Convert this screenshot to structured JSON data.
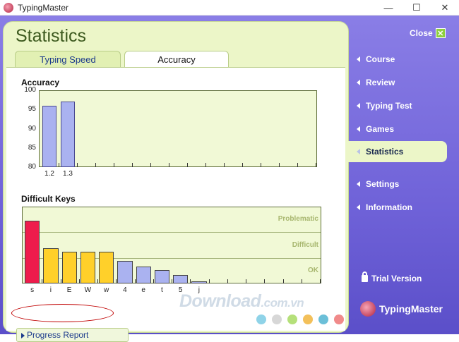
{
  "window": {
    "title": "TypingMaster",
    "minimize": "—",
    "maximize": "☐",
    "close": "✕"
  },
  "page": {
    "title": "Statistics",
    "tabs": [
      {
        "label": "Typing Speed"
      },
      {
        "label": "Accuracy"
      }
    ],
    "progress_report": "Progress Report"
  },
  "sidebar": {
    "close_label": "Close",
    "items": [
      {
        "label": "Course"
      },
      {
        "label": "Review"
      },
      {
        "label": "Typing Test"
      },
      {
        "label": "Games"
      },
      {
        "label": "Statistics"
      },
      {
        "label": "Settings"
      },
      {
        "label": "Information"
      }
    ],
    "trial": "Trial Version",
    "brand": "TypingMaster"
  },
  "watermark": {
    "main": "Download",
    "suffix": ".com.vn"
  },
  "chart_data": [
    {
      "type": "bar",
      "title": "Accuracy",
      "ylim": [
        80,
        100
      ],
      "yticks": [
        "100",
        "95",
        "90",
        "85",
        "80"
      ],
      "categories": [
        "1.2",
        "1.3"
      ],
      "values": [
        96,
        97
      ],
      "slots": 15,
      "colors": {
        "bar": "#aab2f0",
        "background": "#f1f9d6"
      }
    },
    {
      "type": "bar",
      "title": "Difficult Keys",
      "categories": [
        "s",
        "i",
        "E",
        "W",
        "w",
        "4",
        "e",
        "t",
        "5",
        "j"
      ],
      "values": [
        0.82,
        0.46,
        0.41,
        0.41,
        0.41,
        0.29,
        0.22,
        0.17,
        0.11,
        0.03
      ],
      "bands": [
        "Problematic",
        "Difficult",
        "OK"
      ],
      "slots": 16,
      "colors": {
        "problematic": "#ee1c4c",
        "difficult": "#ffd02a",
        "ok": "#aab2f0",
        "background": "#f1f9d6"
      }
    }
  ],
  "colors": {
    "sidebar": "#7a6ee0",
    "panel": "#ecf6c8",
    "accent_title": "#3d5a1f",
    "dots": [
      "#8fd3e8",
      "#d7d7d7",
      "#b5e07a",
      "#f3c05a",
      "#6bbfd8",
      "#f08a8a"
    ]
  }
}
